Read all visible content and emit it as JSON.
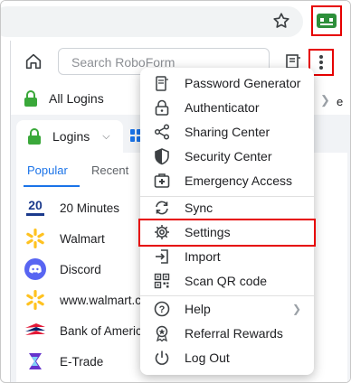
{
  "browser": {
    "star_icon": "bookmark-star-icon",
    "extension_icon": "roboform-extension-icon"
  },
  "popup": {
    "search_placeholder": "Search RoboForm",
    "folder_label": "All Logins",
    "logins_tab_label": "Logins",
    "subtabs": {
      "popular": "Popular",
      "recent": "Recent"
    },
    "edge_text": "e",
    "items": [
      {
        "name": "20 Minutes",
        "icon": "20-minutes-logo"
      },
      {
        "name": "Walmart",
        "icon": "walmart-logo"
      },
      {
        "name": "Discord",
        "icon": "discord-logo"
      },
      {
        "name": "www.walmart.c",
        "icon": "walmart-logo"
      },
      {
        "name": "Bank of Americ",
        "icon": "bank-of-america-logo"
      },
      {
        "name": "E-Trade",
        "icon": "etrade-logo"
      }
    ]
  },
  "menu": {
    "items": [
      {
        "label": "Password Generator",
        "icon": "password-generator-icon"
      },
      {
        "label": "Authenticator",
        "icon": "lock-icon"
      },
      {
        "label": "Sharing Center",
        "icon": "share-icon"
      },
      {
        "label": "Security Center",
        "icon": "shield-icon"
      },
      {
        "label": "Emergency Access",
        "icon": "emergency-icon"
      },
      {
        "label": "Sync",
        "icon": "sync-icon"
      },
      {
        "label": "Settings",
        "icon": "gear-icon"
      },
      {
        "label": "Import",
        "icon": "import-icon"
      },
      {
        "label": "Scan QR code",
        "icon": "qr-code-icon"
      },
      {
        "label": "Help",
        "icon": "help-icon"
      },
      {
        "label": "Referral Rewards",
        "icon": "referral-rewards-icon"
      },
      {
        "label": "Log Out",
        "icon": "power-icon"
      }
    ]
  },
  "colors": {
    "highlight": "#e60000",
    "accent": "#1a73e8",
    "lock_green": "#3aa83a"
  }
}
